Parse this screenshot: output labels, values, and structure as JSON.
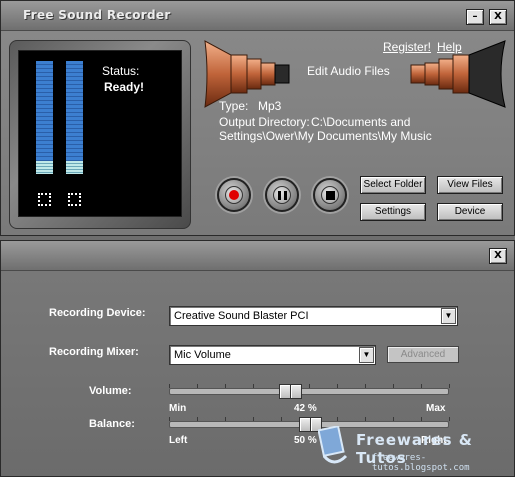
{
  "app": {
    "title": "Free Sound Recorder"
  },
  "top_window": {
    "minimize_label": "–",
    "close_label": "X",
    "status_label": "Status:",
    "status_value": "Ready!",
    "register_link": "Register!",
    "help_link": "Help",
    "edit_audio": "Edit Audio Files",
    "type_label": "Type:",
    "type_value": "Mp3",
    "output_label": "Output Directory:",
    "output_line1": "C:\\Documents and",
    "output_line2": "Settings\\Ower\\My Documents\\My Music",
    "buttons": {
      "select_folder": "Select Folder",
      "view_files": "View Files",
      "settings": "Settings",
      "device": "Device"
    }
  },
  "bottom_window": {
    "close_label": "X",
    "recording_device_label": "Recording Device:",
    "recording_device_value": "Creative Sound Blaster PCI",
    "recording_mixer_label": "Recording Mixer:",
    "recording_mixer_value": "Mic Volume",
    "advanced_label": "Advanced",
    "volume_label": "Volume:",
    "volume_min": "Min",
    "volume_value": "42 %",
    "volume_max": "Max",
    "volume_level": 0.42,
    "balance_label": "Balance:",
    "balance_left": "Left",
    "balance_value": "50 %",
    "balance_right": "Right",
    "balance_level": 0.5
  },
  "watermark": {
    "title": "Freewares & Tutos",
    "url": "freewares-tutos.blogspot.com"
  },
  "colors": {
    "vu_blue": "#3c7fd0",
    "record_red": "#e00000",
    "horn_copper": "#b4552e"
  }
}
